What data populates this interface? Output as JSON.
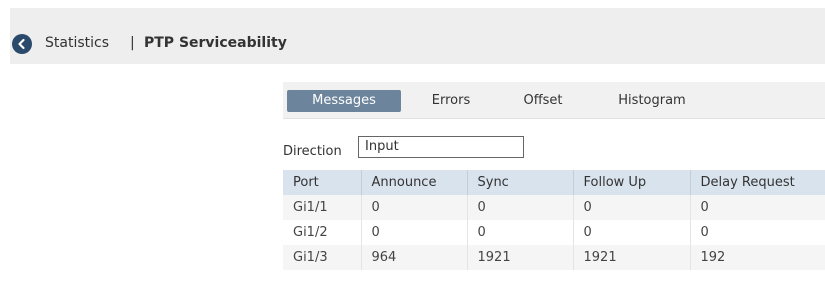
{
  "breadcrumb": {
    "back_icon": "chevron-left-circle-icon",
    "parent": "Statistics",
    "separator": "|",
    "current": "PTP Serviceability"
  },
  "tabs": [
    {
      "label": "Messages",
      "active": true
    },
    {
      "label": "Errors",
      "active": false
    },
    {
      "label": "Offset",
      "active": false
    },
    {
      "label": "Histogram",
      "active": false
    }
  ],
  "direction": {
    "label": "Direction",
    "value": "Input"
  },
  "table": {
    "columns": [
      "Port",
      "Announce",
      "Sync",
      "Follow Up",
      "Delay Request"
    ],
    "rows": [
      [
        "Gi1/1",
        "0",
        "0",
        "0",
        "0"
      ],
      [
        "Gi1/2",
        "0",
        "0",
        "0",
        "0"
      ],
      [
        "Gi1/3",
        "964",
        "1921",
        "1921",
        "192"
      ]
    ]
  },
  "colors": {
    "back_button": "#2b4a6b",
    "active_tab": "#6c849c",
    "header_row": "#d9e3ed"
  }
}
